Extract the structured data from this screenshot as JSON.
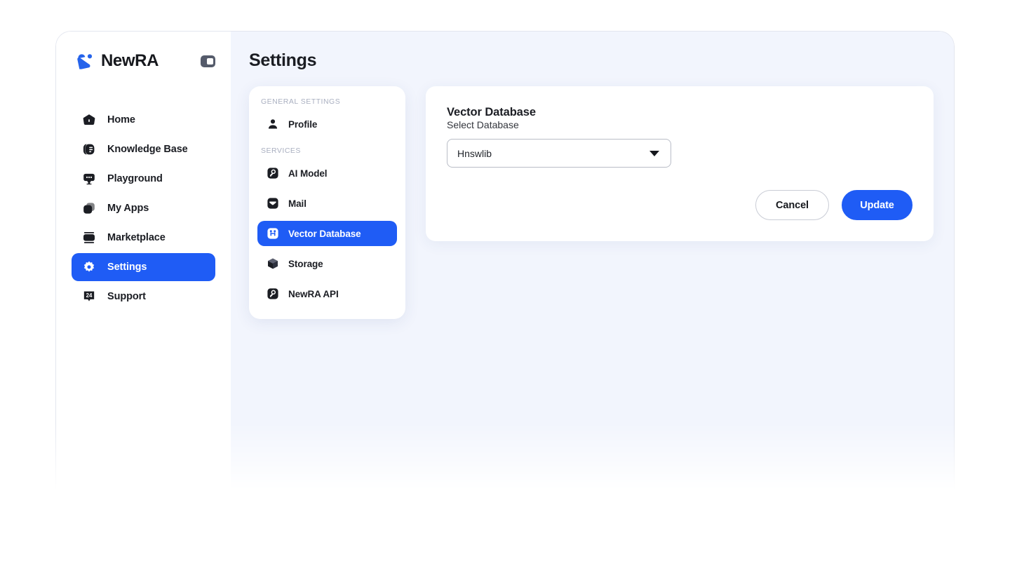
{
  "brand": {
    "name": "NewRA",
    "logo_icon": "newra-logo-icon",
    "collapse_icon": "sidebar-collapse-icon"
  },
  "theme": {
    "accent": "#1f5cf5",
    "main_background": "#f2f5fd",
    "sidebar_background": "#ffffff",
    "text": "#1b1d23",
    "muted_text": "#a9afc0"
  },
  "sidebar": {
    "items": [
      {
        "label": "Home",
        "icon": "home-icon",
        "active": false
      },
      {
        "label": "Knowledge Base",
        "icon": "knowledge-base-icon",
        "active": false
      },
      {
        "label": "Playground",
        "icon": "playground-icon",
        "active": false
      },
      {
        "label": "My Apps",
        "icon": "my-apps-icon",
        "active": false
      },
      {
        "label": "Marketplace",
        "icon": "marketplace-icon",
        "active": false
      },
      {
        "label": "Settings",
        "icon": "gear-icon",
        "active": true
      },
      {
        "label": "Support",
        "icon": "support-24-icon",
        "active": false
      }
    ]
  },
  "header": {
    "title": "Settings"
  },
  "settings_menu": {
    "sections": [
      {
        "title": "GENERAL SETTINGS",
        "items": [
          {
            "label": "Profile",
            "icon": "person-icon",
            "active": false
          }
        ]
      },
      {
        "title": "SERVICES",
        "items": [
          {
            "label": "AI Model",
            "icon": "ai-model-key-icon",
            "active": false
          },
          {
            "label": "Mail",
            "icon": "mail-icon",
            "active": false
          },
          {
            "label": "Vector Database",
            "icon": "vector-database-icon",
            "active": true
          },
          {
            "label": "Storage",
            "icon": "storage-cube-icon",
            "active": false
          },
          {
            "label": "NewRA API",
            "icon": "api-key-icon",
            "active": false
          }
        ]
      }
    ]
  },
  "content": {
    "title": "Vector Database",
    "field_label": "Select Database",
    "select": {
      "value": "Hnswlib",
      "placeholder": "Select Database",
      "caret_icon": "chevron-down-icon"
    },
    "buttons": {
      "cancel": "Cancel",
      "update": "Update"
    }
  }
}
